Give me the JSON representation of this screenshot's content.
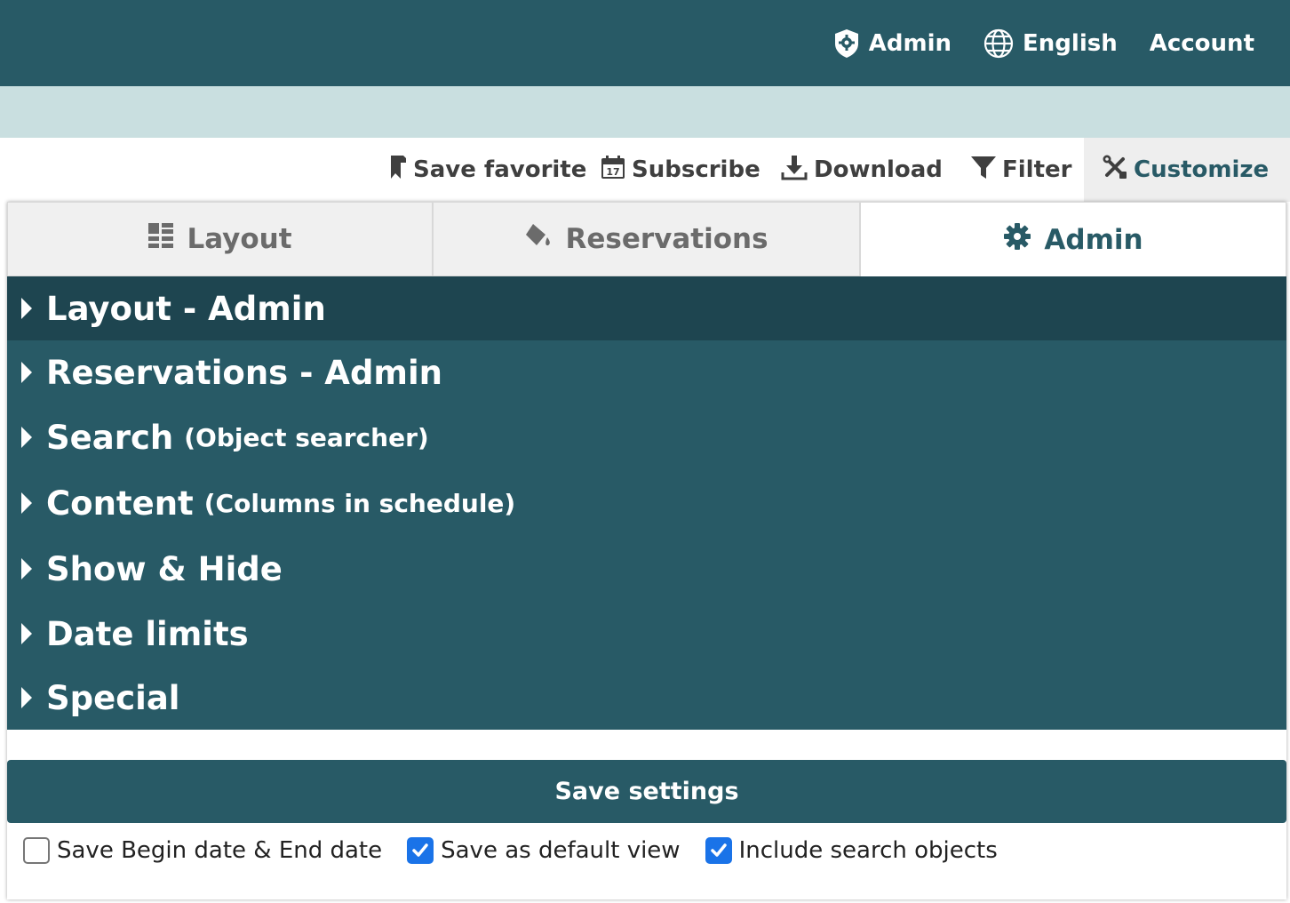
{
  "header": {
    "admin_label": "Admin",
    "language_label": "English",
    "account_label": "Account"
  },
  "toolbar": {
    "save_favorite": "Save favorite",
    "subscribe": "Subscribe",
    "calendar_day": "17",
    "download": "Download",
    "filter": "Filter",
    "customize": "Customize"
  },
  "tabs": [
    {
      "label": "Layout",
      "active": false
    },
    {
      "label": "Reservations",
      "active": false
    },
    {
      "label": "Admin",
      "active": true
    }
  ],
  "accordion": [
    {
      "label": "Layout - Admin",
      "sub": "",
      "active": true
    },
    {
      "label": "Reservations - Admin",
      "sub": "",
      "active": false
    },
    {
      "label": "Search",
      "sub": "(Object searcher)",
      "active": false
    },
    {
      "label": "Content",
      "sub": "(Columns in schedule)",
      "active": false
    },
    {
      "label": "Show & Hide",
      "sub": "",
      "active": false
    },
    {
      "label": "Date limits",
      "sub": "",
      "active": false
    },
    {
      "label": "Special",
      "sub": "",
      "active": false
    }
  ],
  "save_button": "Save settings",
  "options": [
    {
      "label": "Save Begin date & End date",
      "checked": false
    },
    {
      "label": "Save as default view",
      "checked": true
    },
    {
      "label": "Include search objects",
      "checked": true
    }
  ],
  "colors": {
    "brand": "#285a66",
    "brand_dark": "#1e4550",
    "light_band": "#c9dfe0",
    "checkbox_checked": "#1a73e8"
  }
}
